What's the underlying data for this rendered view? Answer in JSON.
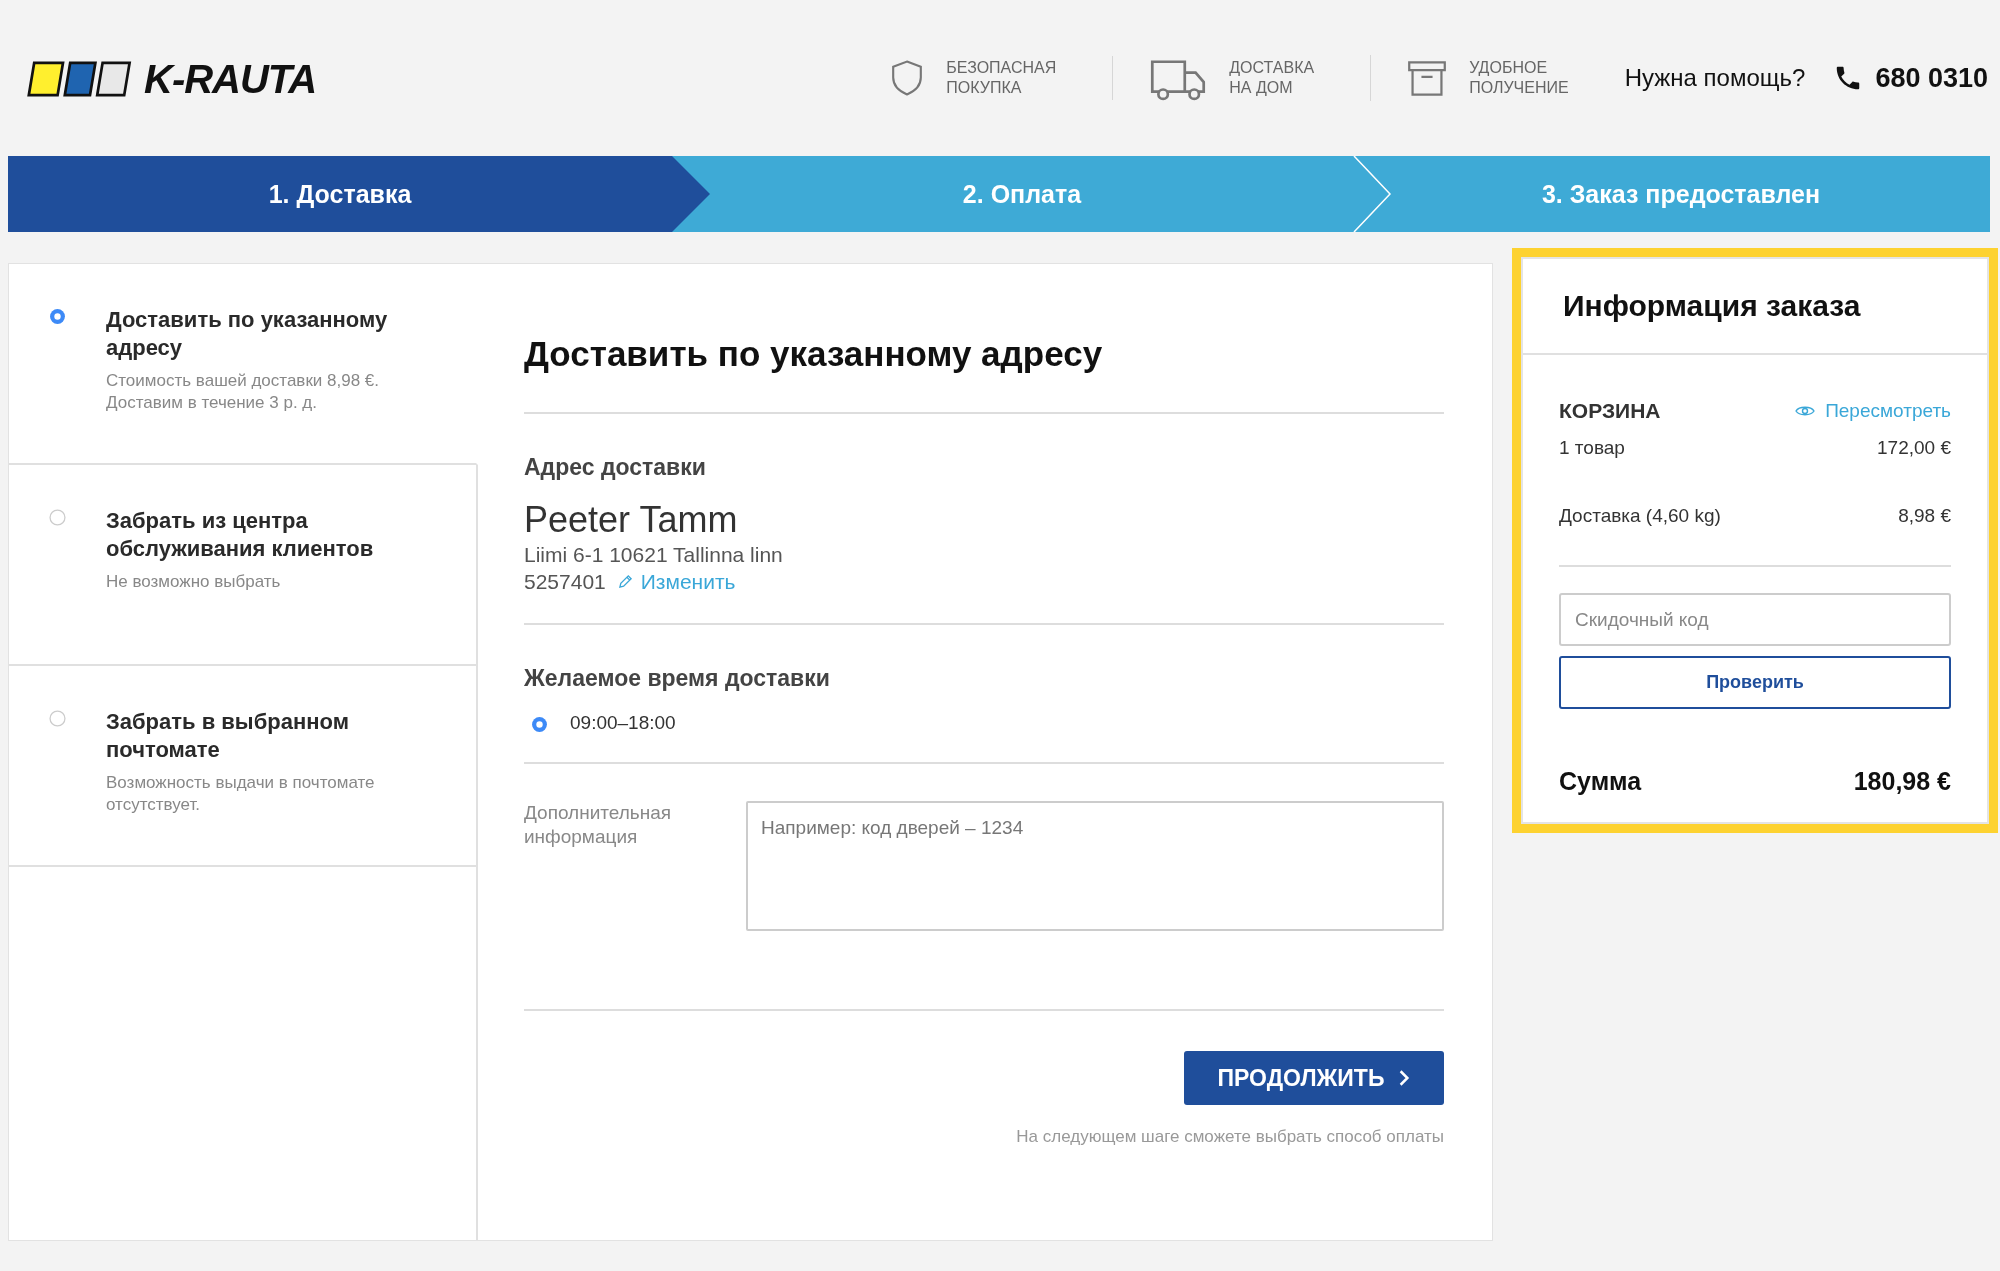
{
  "header": {
    "logo_text": "K-RAUTA",
    "features": [
      {
        "kind": "shield",
        "lines": [
          "БЕЗОПАСНАЯ",
          "ПОКУПКА"
        ]
      },
      {
        "kind": "truck",
        "lines": [
          "ДОСТАВКА",
          "НА ДОМ"
        ]
      },
      {
        "kind": "box",
        "lines": [
          "УДОБНОЕ",
          "ПОЛУЧЕНИЕ"
        ]
      }
    ],
    "help": "Нужна помощь?",
    "phone": "680 0310"
  },
  "steps": [
    {
      "label": "1. Доставка",
      "selected": true
    },
    {
      "label": "2. Оплата",
      "selected": false
    },
    {
      "label": "3. Заказ предоставлен",
      "selected": false
    }
  ],
  "delivery_options": [
    {
      "title": "Доставить по указанному адресу",
      "description": "Стоимость вашей доставки 8,98 €. Доставим в течение 3 р. д.",
      "selected": true
    },
    {
      "title": "Забрать из центра обслуживания клиентов",
      "description": "Не возможно выбрать",
      "selected": false
    },
    {
      "title": "Забрать в выбранном почтомате",
      "description": "Возможность выдачи в почтомате отсутствует.",
      "selected": false
    }
  ],
  "details": {
    "heading": "Доставить по указанному адресу",
    "address": {
      "title": "Адрес доставки",
      "name": "Peeter Tamm",
      "street": "Liimi 6-1 10621 Tallinna linn",
      "phone": "5257401",
      "edit_link": "Изменить"
    },
    "delivery_time": {
      "title": "Желаемое время доставки",
      "slots": [
        {
          "label": "09:00–18:00",
          "selected": true
        }
      ]
    },
    "extra_info": {
      "label": "Дополнительная информация",
      "placeholder": "Например: код дверей – 1234"
    },
    "continue_button": "ПРОДОЛЖИТЬ",
    "note": "На следующем шаге сможете выбрать способ оплаты"
  },
  "order_summary": {
    "highlighted": true,
    "title": "Информация заказа",
    "cart_title": "КОРЗИНА",
    "review_link": "Пересмотреть",
    "lines": [
      {
        "label": "1 товар",
        "amount": "172,00 €"
      },
      {
        "label": "Доставка (4,60 kg)",
        "amount": "8,98 €"
      }
    ],
    "discount": {
      "placeholder": "Скидочный код",
      "button": "Проверить"
    },
    "total": {
      "label": "Сумма",
      "amount": "180,98 €"
    }
  }
}
